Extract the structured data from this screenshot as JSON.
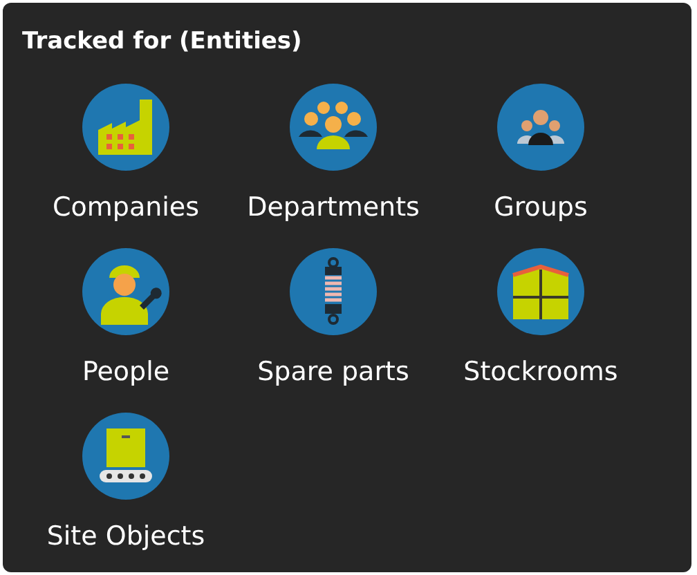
{
  "panel": {
    "title": "Tracked for (Entities)"
  },
  "entities": [
    {
      "label": "Companies",
      "kind": "factory"
    },
    {
      "label": "Departments",
      "kind": "crowd"
    },
    {
      "label": "Groups",
      "kind": "team"
    },
    {
      "label": "People",
      "kind": "worker"
    },
    {
      "label": "Spare parts",
      "kind": "shock"
    },
    {
      "label": "Stockrooms",
      "kind": "boxes"
    },
    {
      "label": "Site Objects",
      "kind": "conveyor"
    }
  ]
}
